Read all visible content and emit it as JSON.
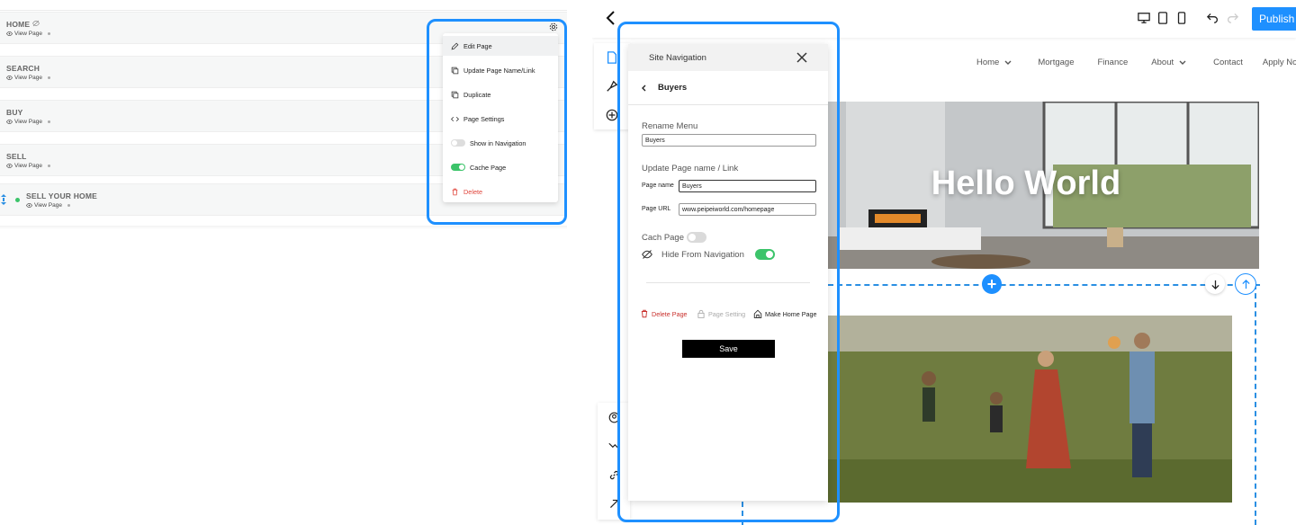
{
  "left": {
    "pages": [
      {
        "title": "HOME",
        "view_label": "View Page",
        "hidden": true
      },
      {
        "title": "SEARCH",
        "view_label": "View Page"
      },
      {
        "title": "BUY",
        "view_label": "View Page"
      },
      {
        "title": "SELL",
        "view_label": "View Page"
      },
      {
        "title": "SELL YOUR HOME",
        "view_label": "View Page"
      }
    ],
    "menu": {
      "edit_page": "Edit Page",
      "update_name": "Update Page Name/Link",
      "duplicate": "Duplicate",
      "page_settings": "Page Settings",
      "show_in_navigation": "Show in Navigation",
      "show_in_navigation_on": false,
      "cache_page": "Cache Page",
      "cache_page_on": true,
      "delete": "Delete"
    }
  },
  "editor": {
    "publish_label": "Publish S",
    "site_nav": [
      "Home",
      "Mortgage",
      "Finance",
      "About",
      "Contact",
      "Apply Now"
    ],
    "hero_title": "Hello World",
    "dialog": {
      "title": "Site Navigation",
      "sub_title": "Buyers",
      "rename_label": "Rename Menu",
      "rename_value": "Buyers",
      "update_label": "Update Page name / Link",
      "page_name_label": "Page name",
      "page_name_value": "Buyers",
      "page_url_label": "Page URL",
      "page_url_value": "www.peipeiworld.com/homepage",
      "cach_page_label": "Cach Page",
      "cach_page_on": false,
      "hide_nav_label": "Hide From Navigation",
      "hide_nav_on": true,
      "delete_label": "Delete Page",
      "setting_label": "Page Setting",
      "make_home_label": "Make Home Page",
      "save_label": "Save"
    }
  },
  "colors": {
    "accent": "#1e90ff",
    "toggle_on": "#3cc46a",
    "danger": "#c9302c"
  }
}
